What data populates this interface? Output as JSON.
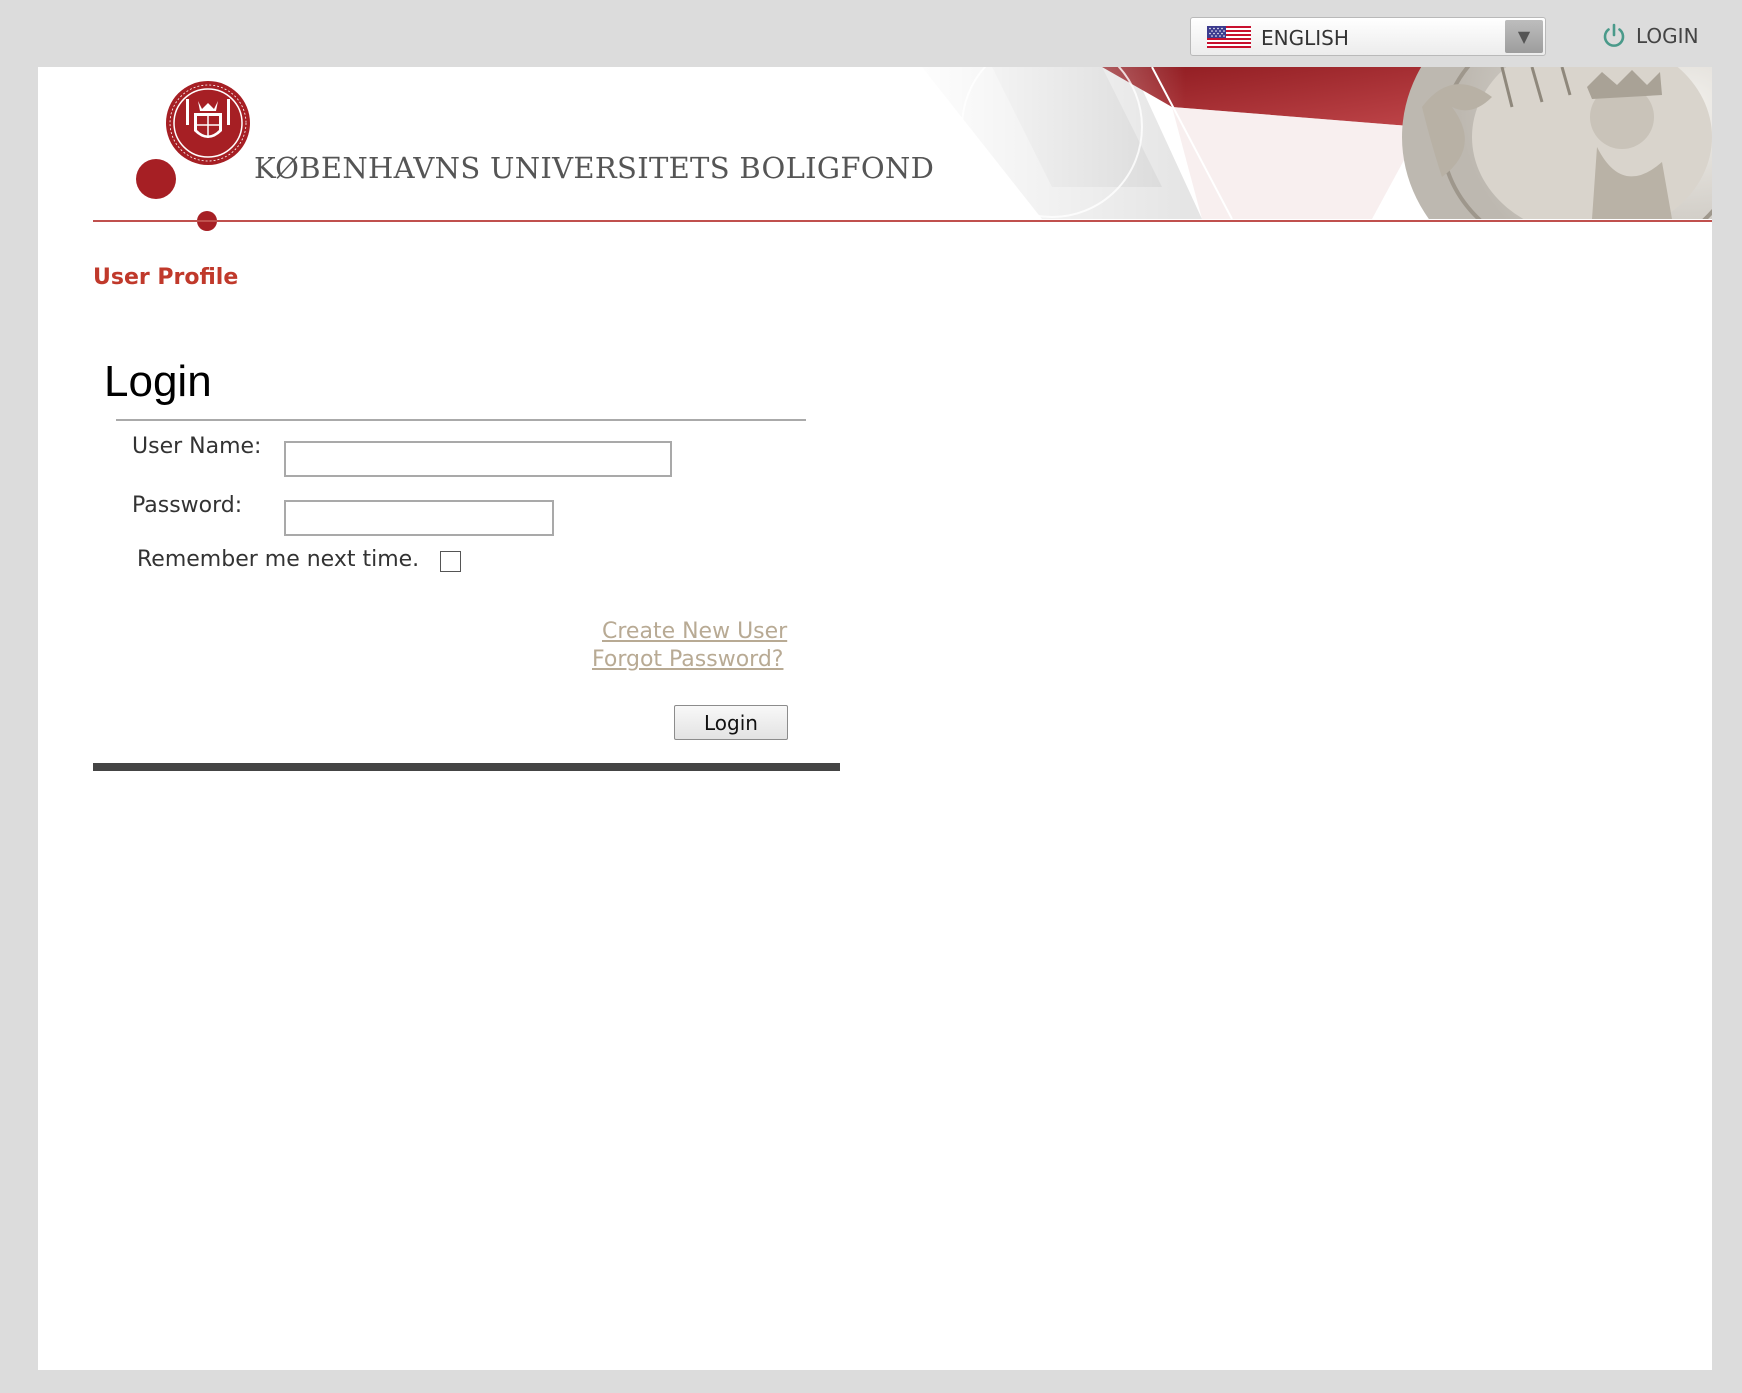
{
  "language_selector": {
    "selected": "ENGLISH",
    "flag_icon": "us-flag-icon",
    "arrow_icon": "dropdown-arrow-icon"
  },
  "top_nav": {
    "login_label": "LOGIN",
    "login_icon": "power-icon",
    "login_icon_color": "#4a9a8a"
  },
  "header": {
    "site_title": "KØBENHAVNS UNIVERSITETS BOLIGFOND",
    "logo": "university-seal-logo",
    "brand_color": "#a61f24"
  },
  "breadcrumb": {
    "user_profile": "User Profile"
  },
  "login_form": {
    "heading": "Login",
    "username_label": "User Name:",
    "username_value": "",
    "password_label": "Password:",
    "password_value": "",
    "remember_label": "Remember me next time.",
    "remember_checked": false,
    "create_user_link": "Create New User",
    "forgot_password_link": "Forgot Password?",
    "submit_label": "Login"
  }
}
